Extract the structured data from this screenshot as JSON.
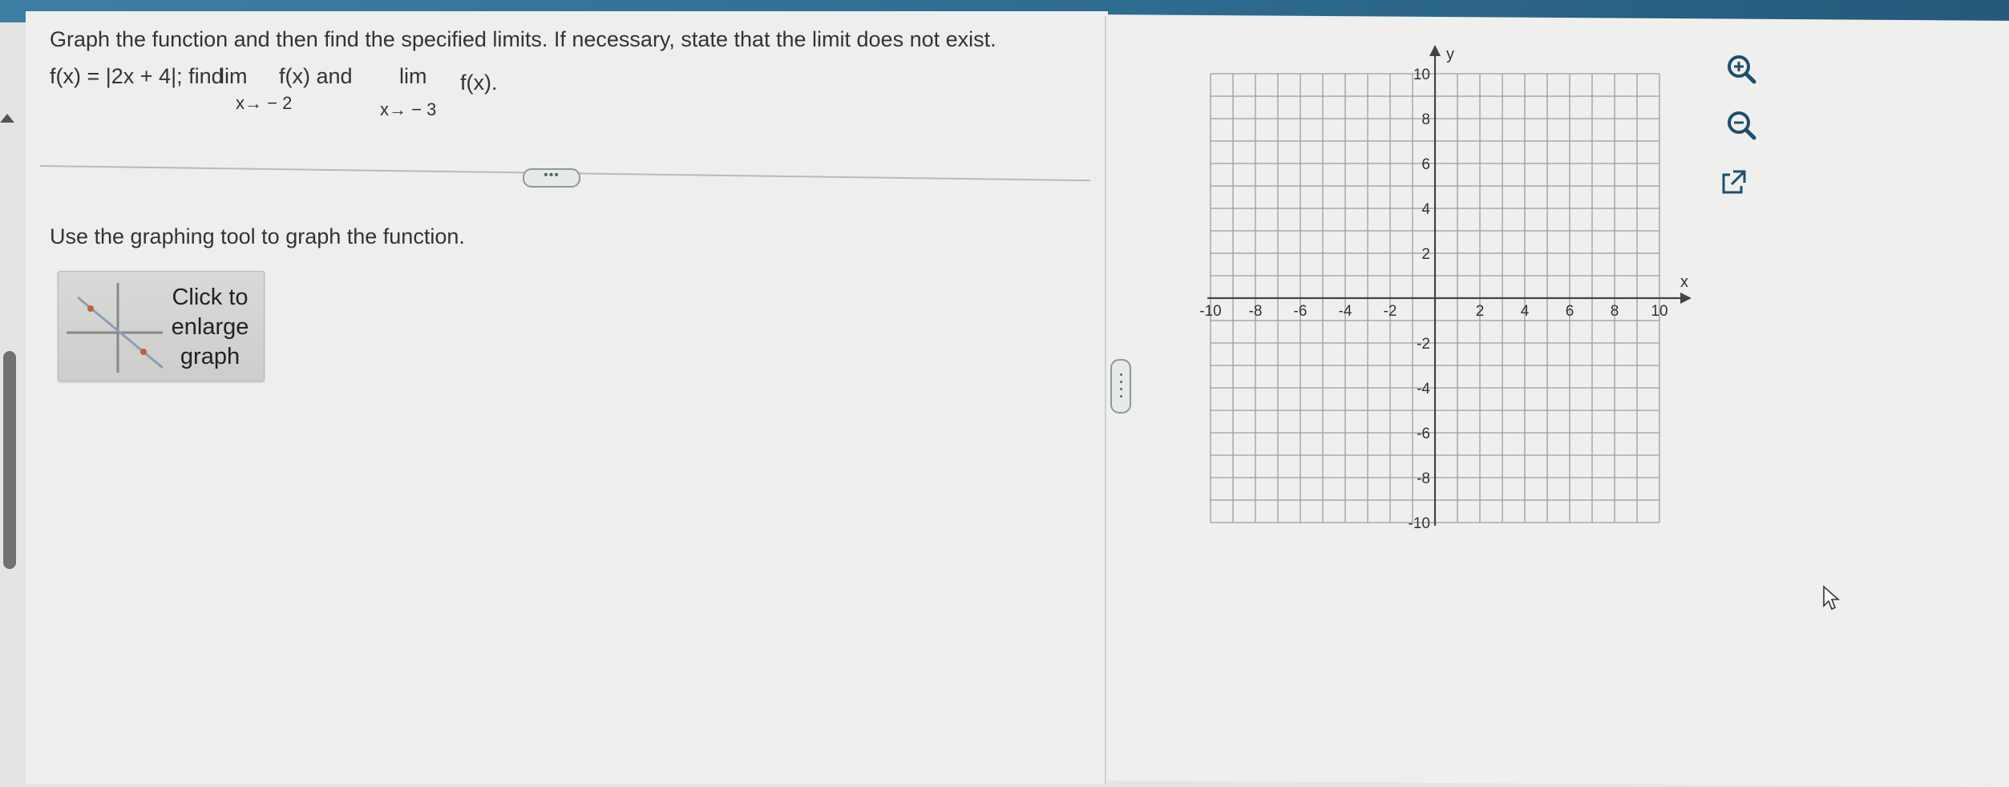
{
  "question": {
    "text": "Graph the function and then find the specified limits. If necessary, state that the limit does not exist.",
    "fx_prefix": "f(x) = |2x + 4|; find",
    "lim1": "lim",
    "lim1_sub": "x→ − 2",
    "lim1_fx": "f(x) and",
    "lim2": "lim",
    "lim2_sub": "x→ − 3",
    "lim2_fx": "f(x).",
    "more_button": "•••"
  },
  "instructions": "Use the graphing tool to graph the function.",
  "enlarge_button": {
    "line1": "Click to",
    "line2": "enlarge",
    "line3": "graph"
  },
  "graph": {
    "x_axis_label": "x",
    "y_axis_label": "y",
    "x_ticks": [
      "-10",
      "-8",
      "-6",
      "-4",
      "-2",
      "2",
      "4",
      "6",
      "8",
      "10"
    ],
    "y_ticks": [
      "10",
      "8",
      "6",
      "4",
      "2",
      "-2",
      "-4",
      "-6",
      "-8",
      "-10"
    ],
    "x_range": [
      -10,
      10
    ],
    "y_range": [
      -10,
      10
    ],
    "grid": true,
    "grid_step": 1
  },
  "tools": {
    "zoom_in": "zoom-in-icon",
    "zoom_out": "zoom-out-icon",
    "popout": "popout-icon"
  },
  "colors": {
    "accent": "#2d6a8e",
    "tool_icon": "#1f4e6e"
  }
}
